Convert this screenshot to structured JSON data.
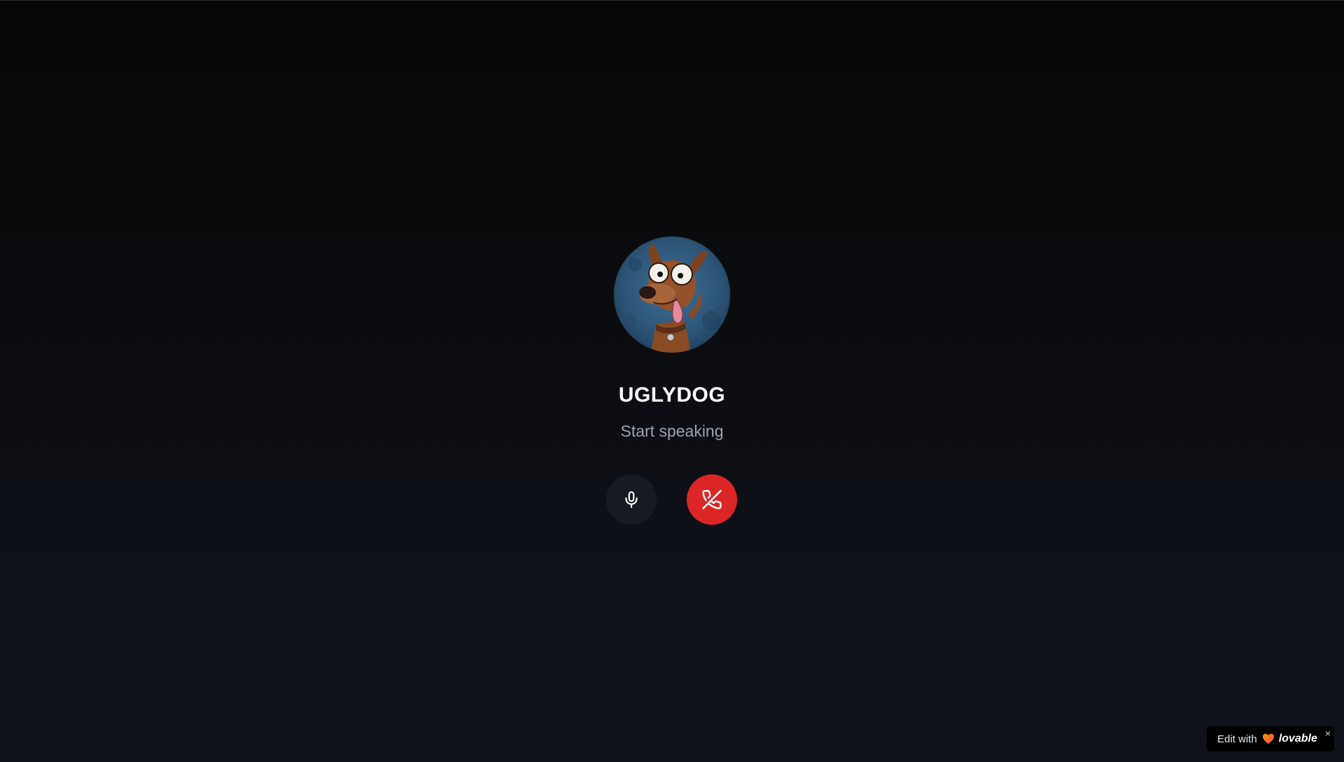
{
  "call": {
    "agent_name": "UGLYDOG",
    "status_text": "Start speaking",
    "avatar_icon": "ugly-dog-avatar",
    "mic_icon": "microphone-icon",
    "end_call_icon": "phone-off-icon",
    "colors": {
      "end_call": "#dc2626",
      "mic_button": "#161a22",
      "status": "#9ca3af"
    }
  },
  "badge": {
    "edit_with": "Edit with",
    "brand": "lovable",
    "close_glyph": "×",
    "heart_icon": "lovable-heart-icon"
  }
}
